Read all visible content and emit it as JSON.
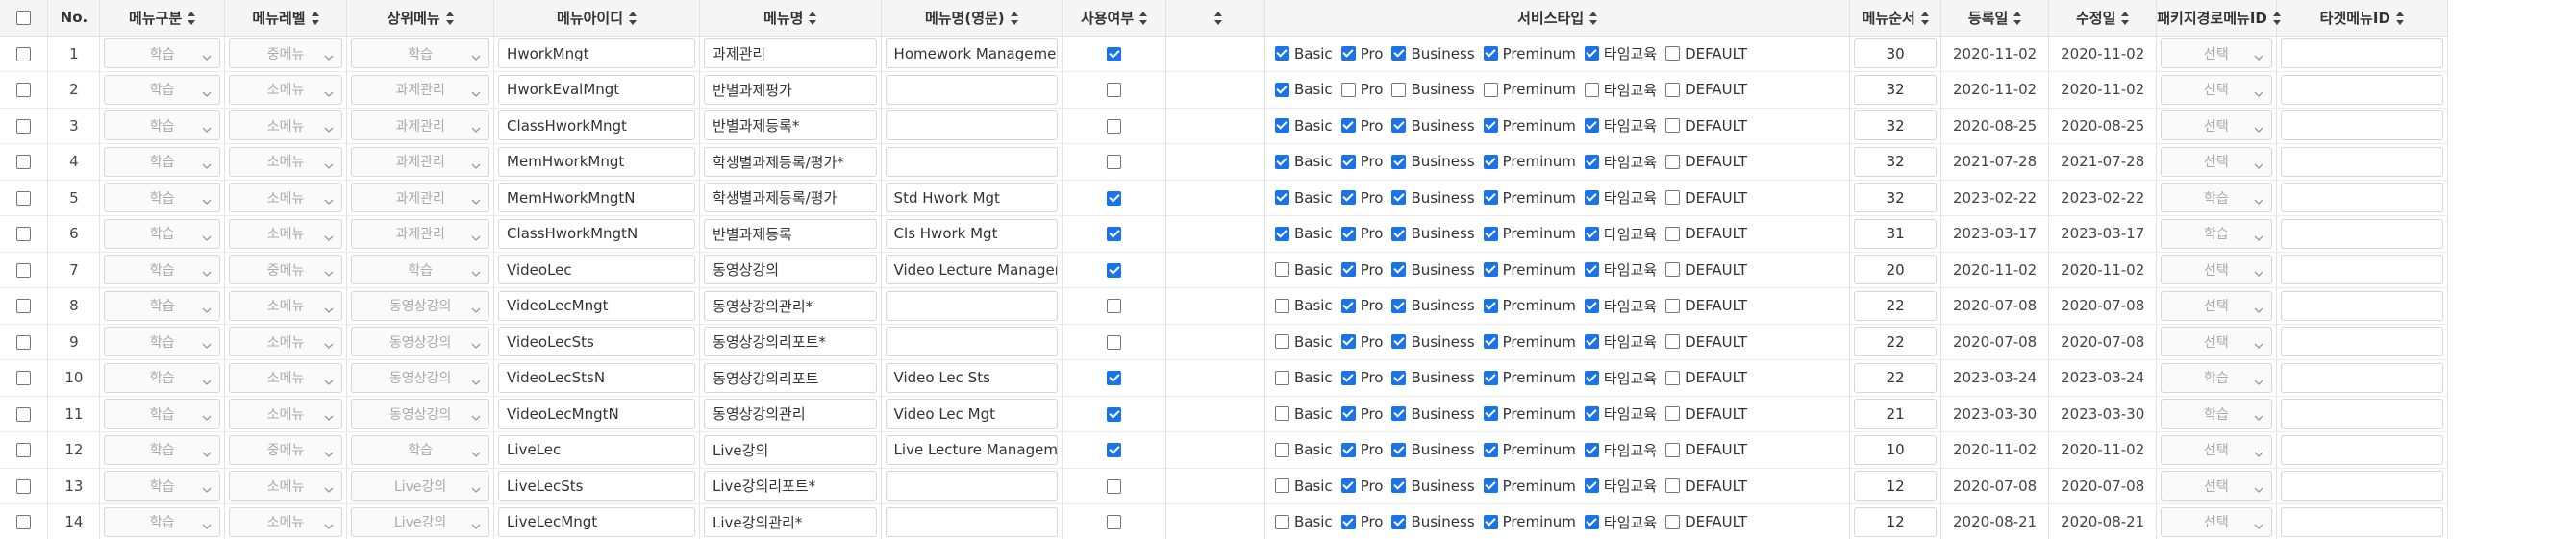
{
  "columns": {
    "no": "No.",
    "menu_type": "메뉴구분",
    "menu_level": "메뉴레벨",
    "parent_menu": "상위메뉴",
    "menu_id": "메뉴아이디",
    "menu_name": "메뉴명",
    "menu_name_en": "메뉴명(영문)",
    "use_yn": "사용여부",
    "blank": "",
    "service_type": "서비스타입",
    "menu_order": "메뉴순서",
    "reg_date": "등록일",
    "mod_date": "수정일",
    "pkg_path_menu_id": "패키지경로메뉴ID",
    "target_menu_id": "타겟메뉴ID"
  },
  "service_labels": [
    "Basic",
    "Pro",
    "Business",
    "Preminum",
    "타임교육",
    "DEFAULT"
  ],
  "rows": [
    {
      "no": "1",
      "type": "학습",
      "level": "중메뉴",
      "parent": "학습",
      "id": "HworkMngt",
      "name": "과제관리",
      "name_en": "Homework Managemen",
      "use": true,
      "svc": [
        true,
        true,
        true,
        true,
        true,
        false
      ],
      "order": "30",
      "reg": "2020-11-02",
      "mod": "2020-11-02",
      "pkg": "선택",
      "target": ""
    },
    {
      "no": "2",
      "type": "학습",
      "level": "소메뉴",
      "parent": "과제관리",
      "id": "HworkEvalMngt",
      "name": "반별과제평가",
      "name_en": "",
      "use": false,
      "svc": [
        true,
        false,
        false,
        false,
        false,
        false
      ],
      "order": "32",
      "reg": "2020-11-02",
      "mod": "2020-11-02",
      "pkg": "선택",
      "target": ""
    },
    {
      "no": "3",
      "type": "학습",
      "level": "소메뉴",
      "parent": "과제관리",
      "id": "ClassHworkMngt",
      "name": "반별과제등록*",
      "name_en": "",
      "use": false,
      "svc": [
        true,
        true,
        true,
        true,
        true,
        false
      ],
      "order": "32",
      "reg": "2020-08-25",
      "mod": "2020-08-25",
      "pkg": "선택",
      "target": ""
    },
    {
      "no": "4",
      "type": "학습",
      "level": "소메뉴",
      "parent": "과제관리",
      "id": "MemHworkMngt",
      "name": "학생별과제등록/평가*",
      "name_en": "",
      "use": false,
      "svc": [
        true,
        true,
        true,
        true,
        true,
        false
      ],
      "order": "32",
      "reg": "2021-07-28",
      "mod": "2021-07-28",
      "pkg": "선택",
      "target": ""
    },
    {
      "no": "5",
      "type": "학습",
      "level": "소메뉴",
      "parent": "과제관리",
      "id": "MemHworkMngtN",
      "name": "학생별과제등록/평가",
      "name_en": "Std Hwork Mgt",
      "use": true,
      "svc": [
        true,
        true,
        true,
        true,
        true,
        false
      ],
      "order": "32",
      "reg": "2023-02-22",
      "mod": "2023-02-22",
      "pkg": "학습",
      "target": ""
    },
    {
      "no": "6",
      "type": "학습",
      "level": "소메뉴",
      "parent": "과제관리",
      "id": "ClassHworkMngtN",
      "name": "반별과제등록",
      "name_en": "Cls Hwork Mgt",
      "use": true,
      "svc": [
        true,
        true,
        true,
        true,
        true,
        false
      ],
      "order": "31",
      "reg": "2023-03-17",
      "mod": "2023-03-17",
      "pkg": "학습",
      "target": ""
    },
    {
      "no": "7",
      "type": "학습",
      "level": "중메뉴",
      "parent": "학습",
      "id": "VideoLec",
      "name": "동영상강의",
      "name_en": "Video Lecture Managem",
      "use": true,
      "svc": [
        false,
        true,
        true,
        true,
        true,
        false
      ],
      "order": "20",
      "reg": "2020-11-02",
      "mod": "2020-11-02",
      "pkg": "선택",
      "target": ""
    },
    {
      "no": "8",
      "type": "학습",
      "level": "소메뉴",
      "parent": "동영상강의",
      "id": "VideoLecMngt",
      "name": "동영상강의관리*",
      "name_en": "",
      "use": false,
      "svc": [
        false,
        true,
        true,
        true,
        true,
        false
      ],
      "order": "22",
      "reg": "2020-07-08",
      "mod": "2020-07-08",
      "pkg": "선택",
      "target": ""
    },
    {
      "no": "9",
      "type": "학습",
      "level": "소메뉴",
      "parent": "동영상강의",
      "id": "VideoLecSts",
      "name": "동영상강의리포트*",
      "name_en": "",
      "use": false,
      "svc": [
        false,
        true,
        true,
        true,
        true,
        false
      ],
      "order": "22",
      "reg": "2020-07-08",
      "mod": "2020-07-08",
      "pkg": "선택",
      "target": ""
    },
    {
      "no": "10",
      "type": "학습",
      "level": "소메뉴",
      "parent": "동영상강의",
      "id": "VideoLecStsN",
      "name": "동영상강의리포트",
      "name_en": "Video Lec Sts",
      "use": true,
      "svc": [
        false,
        true,
        true,
        true,
        true,
        false
      ],
      "order": "22",
      "reg": "2023-03-24",
      "mod": "2023-03-24",
      "pkg": "학습",
      "target": ""
    },
    {
      "no": "11",
      "type": "학습",
      "level": "소메뉴",
      "parent": "동영상강의",
      "id": "VideoLecMngtN",
      "name": "동영상강의관리",
      "name_en": "Video Lec Mgt",
      "use": true,
      "svc": [
        false,
        true,
        true,
        true,
        true,
        false
      ],
      "order": "21",
      "reg": "2023-03-30",
      "mod": "2023-03-30",
      "pkg": "학습",
      "target": ""
    },
    {
      "no": "12",
      "type": "학습",
      "level": "중메뉴",
      "parent": "학습",
      "id": "LiveLec",
      "name": "Live강의",
      "name_en": "Live Lecture Managem",
      "use": true,
      "svc": [
        false,
        true,
        true,
        true,
        true,
        false
      ],
      "order": "10",
      "reg": "2020-11-02",
      "mod": "2020-11-02",
      "pkg": "선택",
      "target": ""
    },
    {
      "no": "13",
      "type": "학습",
      "level": "소메뉴",
      "parent": "Live강의",
      "id": "LiveLecSts",
      "name": "Live강의리포트*",
      "name_en": "",
      "use": false,
      "svc": [
        false,
        true,
        true,
        true,
        true,
        false
      ],
      "order": "12",
      "reg": "2020-07-08",
      "mod": "2020-07-08",
      "pkg": "선택",
      "target": ""
    },
    {
      "no": "14",
      "type": "학습",
      "level": "소메뉴",
      "parent": "Live강의",
      "id": "LiveLecMngt",
      "name": "Live강의관리*",
      "name_en": "",
      "use": false,
      "svc": [
        false,
        true,
        true,
        true,
        true,
        false
      ],
      "order": "12",
      "reg": "2020-08-21",
      "mod": "2020-08-21",
      "pkg": "선택",
      "target": ""
    }
  ]
}
